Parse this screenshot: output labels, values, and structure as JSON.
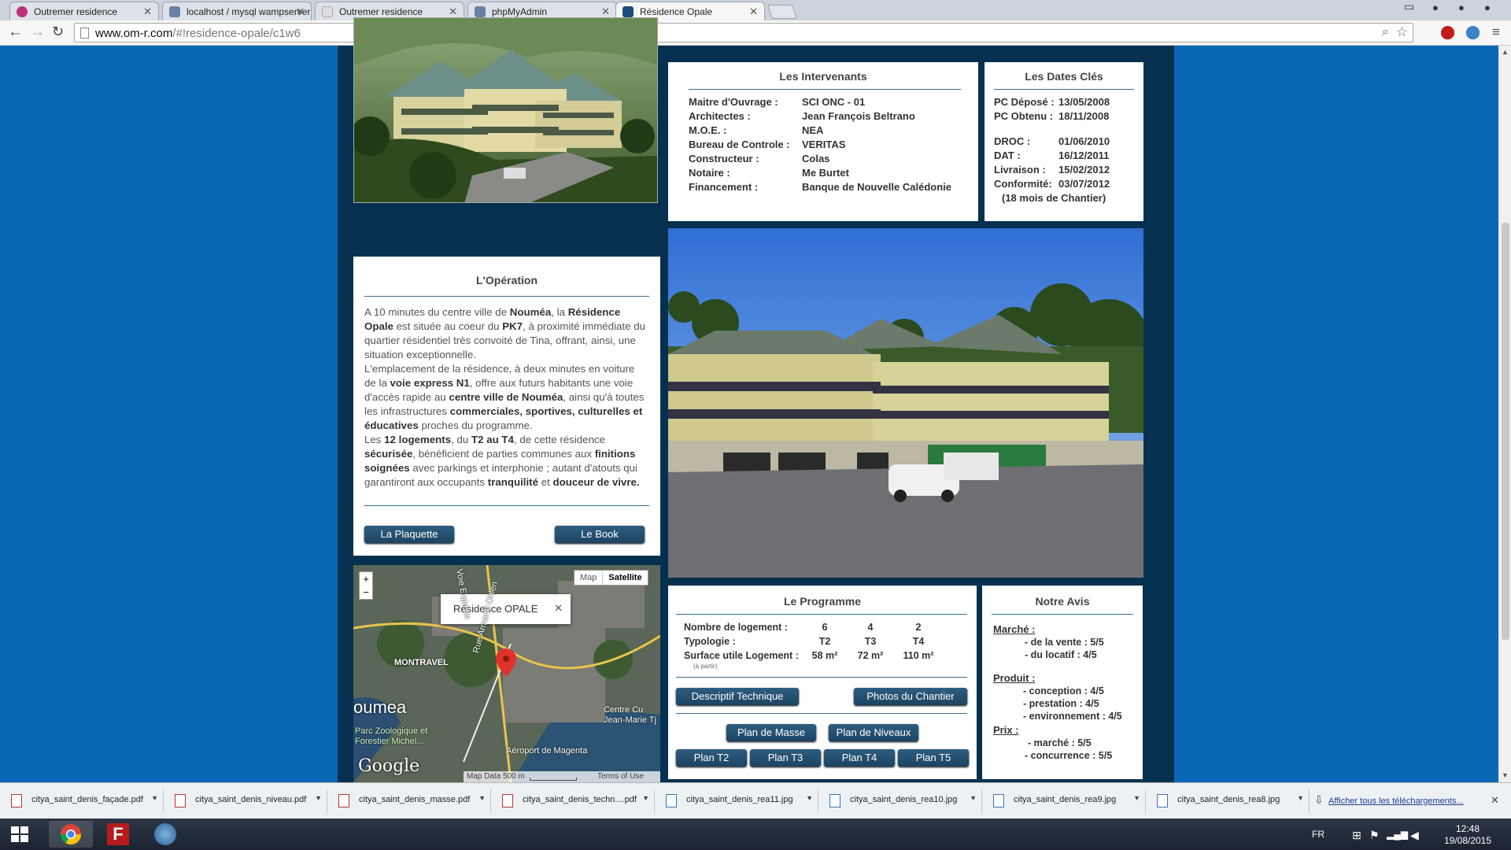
{
  "browser": {
    "tabs": [
      {
        "title": "Outremer residence",
        "icon_color": "#c0307a"
      },
      {
        "title": "localhost / mysql wampserver",
        "icon_color": "#6a7fa6"
      },
      {
        "title": "Outremer residence",
        "icon_color": "#dddddd"
      },
      {
        "title": "phpMyAdmin",
        "icon_color": "#6a7fa6"
      },
      {
        "title": "Résidence Opale",
        "icon_color": "#1c4a7a"
      }
    ],
    "url_host": "www.om-r.com",
    "url_path": "/#!residence-opale/c1w6"
  },
  "intervenants": {
    "title": "Les Intervenants",
    "rows": [
      {
        "label": "Maitre d'Ouvrage :",
        "value": "SCI ONC - 01"
      },
      {
        "label": "Architectes :",
        "value": "Jean François Beltrano"
      },
      {
        "label": "M.O.E. :",
        "value": "NEA"
      },
      {
        "label": "Bureau de Controle :",
        "value": "VERITAS"
      },
      {
        "label": "Constructeur :",
        "value": "Colas"
      },
      {
        "label": "Notaire :",
        "value": "Me Burtet"
      },
      {
        "label": "Financement :",
        "value": "Banque de Nouvelle Calédonie"
      }
    ]
  },
  "dates": {
    "title": "Les Dates Clés",
    "rows1": [
      {
        "label": "PC Déposé :",
        "value": "13/05/2008"
      },
      {
        "label": "PC Obtenu :",
        "value": "18/11/2008"
      }
    ],
    "rows2": [
      {
        "label": "DROC :",
        "value": "01/06/2010"
      },
      {
        "label": "DAT :",
        "value": "16/12/2011"
      },
      {
        "label": "Livraison :",
        "value": "15/02/2012"
      },
      {
        "label": "Conformité:",
        "value": "03/07/2012"
      }
    ],
    "note": "(18 mois de Chantier)"
  },
  "operation": {
    "title": "L'Opération",
    "p1_a": "A 10 minutes du centre ville de ",
    "p1_b": "Nouméa",
    "p1_c": ", la ",
    "p1_d": "Résidence Opale",
    "p1_e": " est située au coeur du ",
    "p1_f": "PK7",
    "p1_g": ", à proximité immédiate du quartier résidentiel très convoité de Tina, offrant, ainsi, une situation exceptionnelle.",
    "p2_a": "L'emplacement de la résidence, à deux minutes en voiture de la ",
    "p2_b": "voie express N1",
    "p2_c": ", offre aux futurs habitants une voie d'accès rapide au ",
    "p2_d": "centre ville de Nouméa",
    "p2_e": ", ainsi qu'à toutes les infrastructures ",
    "p2_f": "commerciales, sportives, culturelles et éducatives",
    "p2_g": " proches du programme.",
    "p3_a": "Les ",
    "p3_b": "12 logements",
    "p3_c": ", du ",
    "p3_d": "T2 au T4",
    "p3_e": ", de cette résidence ",
    "p3_f": "sécurisée",
    "p3_g": ", bénéficient de parties communes aux ",
    "p3_h": "finitions soignées",
    "p3_i": " avec parkings et interphonie ; autant d'atouts qui garantiront aux occupants ",
    "p3_j": "tranquilité",
    "p3_k": " et ",
    "p3_l": "douceur de vivre.",
    "btn_plaquette": "La Plaquette",
    "btn_book": "Le Book"
  },
  "map": {
    "btn_map": "Map",
    "btn_satellite": "Satellite",
    "zoom_in": "+",
    "zoom_out": "−",
    "popup": "Résidence OPALE",
    "popup_close": "✕",
    "label_montravel": "MONTRAVEL",
    "label_noumea": "oumea",
    "label_parc": "Parc Zoologique et Forestier Michel...",
    "label_aeroport": "Aéroport de Magenta",
    "label_centre": "Centre Cu Jean-Marie Tj",
    "label_road": "Rue Armand Ohlen",
    "label_express": "Voie Express",
    "google": "Google",
    "footer_data": "Map Data",
    "footer_scale": "500 m",
    "footer_terms": "Terms of Use"
  },
  "programme": {
    "title": "Le Programme",
    "row1_label": "Nombre de logement :",
    "row1_vals": [
      "6",
      "4",
      "2"
    ],
    "row2_label": "Typologie :",
    "row2_vals": [
      "T2",
      "T3",
      "T4"
    ],
    "row3_label": "Surface utile Logement :",
    "row3_vals": [
      "58 m²",
      "72 m²",
      "110 m²"
    ],
    "row3_note": "(à partir)",
    "btn_descriptif": "Descriptif Technique",
    "btn_photos": "Photos du Chantier",
    "btn_masse": "Plan de Masse",
    "btn_niveaux": "Plan de Niveaux",
    "btn_t2": "Plan T2",
    "btn_t3": "Plan T3",
    "btn_t4": "Plan T4",
    "btn_t5": "Plan T5"
  },
  "avis": {
    "title": "Notre Avis",
    "marche": "Marché :",
    "vente": "- de la vente : 5/5",
    "locatif": "- du locatif : 4/5",
    "produit": "Produit :",
    "conception": "- conception : 4/5",
    "prestation": "- prestation : 4/5",
    "environnement": "- environnement : 4/5",
    "prix": "Prix :",
    "prix_marche": "- marché : 5/5",
    "concurrence": "- concurrence : 5/5"
  },
  "downloads": {
    "items": [
      {
        "name": "citya_saint_denis_façade.pdf",
        "type": "pdf"
      },
      {
        "name": "citya_saint_denis_niveau.pdf",
        "type": "pdf"
      },
      {
        "name": "citya_saint_denis_masse.pdf",
        "type": "pdf"
      },
      {
        "name": "citya_saint_denis_techn....pdf",
        "type": "pdf"
      },
      {
        "name": "citya_saint_denis_rea11.jpg",
        "type": "jpg"
      },
      {
        "name": "citya_saint_denis_rea10.jpg",
        "type": "jpg"
      },
      {
        "name": "citya_saint_denis_rea9.jpg",
        "type": "jpg"
      },
      {
        "name": "citya_saint_denis_rea8.jpg",
        "type": "jpg"
      }
    ],
    "show_all": "Afficher tous les téléchargements...",
    "close": "✕"
  },
  "taskbar": {
    "lang": "FR",
    "time": "12:48",
    "date": "19/08/2015"
  }
}
